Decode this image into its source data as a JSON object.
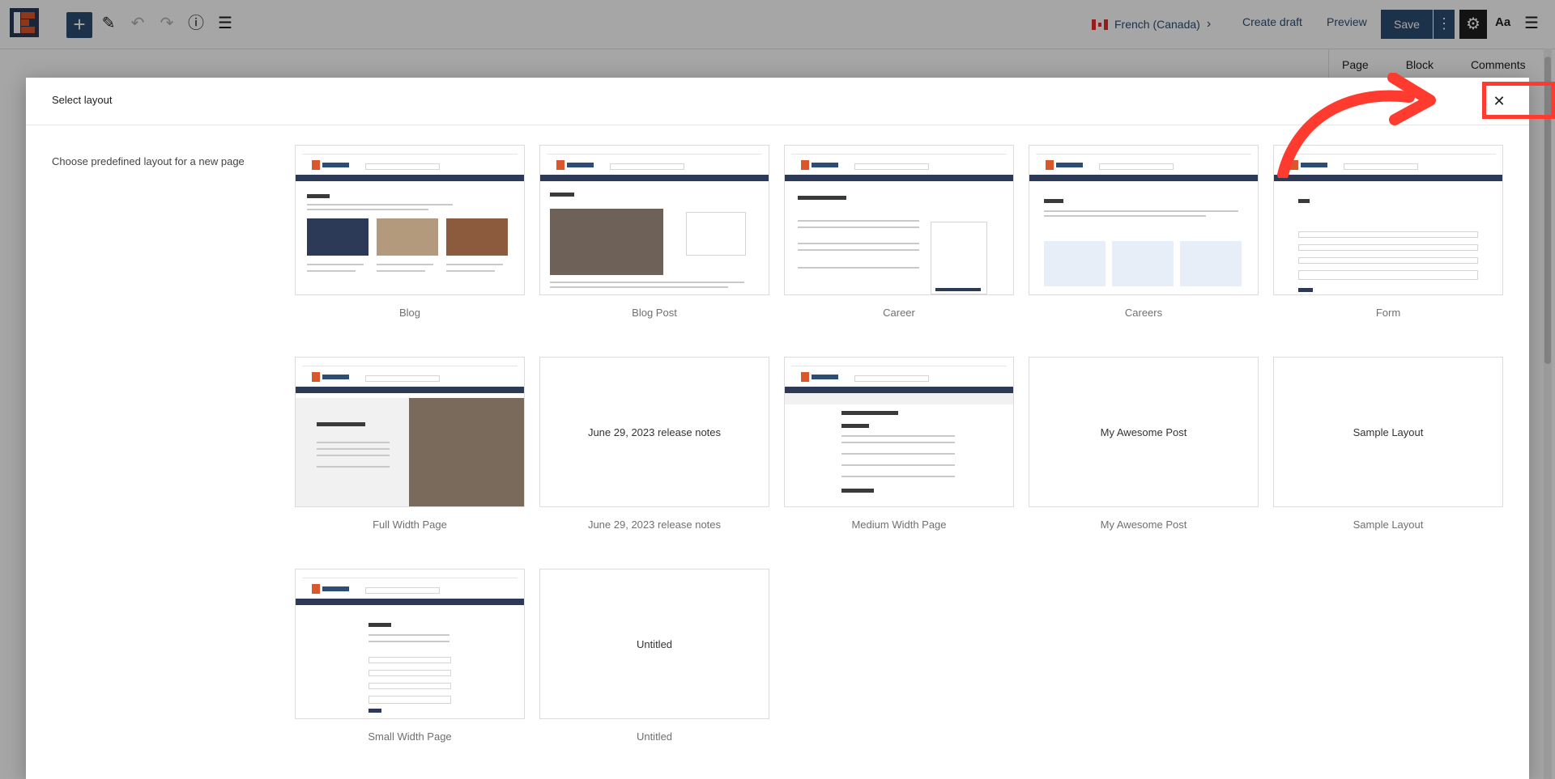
{
  "toolbar": {
    "language": "French (Canada)",
    "create_draft": "Create draft",
    "preview": "Preview",
    "save": "Save",
    "typography": "Aa"
  },
  "sidebar_tabs": [
    "Page",
    "Block",
    "Comments"
  ],
  "modal": {
    "title": "Select layout",
    "hint": "Choose predefined layout for a new page",
    "close_icon": "close-icon"
  },
  "layouts": [
    {
      "label": "Blog",
      "preview": "blog"
    },
    {
      "label": "Blog Post",
      "preview": "blog-post"
    },
    {
      "label": "Career",
      "preview": "career"
    },
    {
      "label": "Careers",
      "preview": "careers"
    },
    {
      "label": "Form",
      "preview": "form"
    },
    {
      "label": "Full Width Page",
      "preview": "full-width"
    },
    {
      "label": "June 29, 2023 release notes",
      "preview_text": "June 29, 2023 release notes"
    },
    {
      "label": "Medium Width Page",
      "preview": "medium-width"
    },
    {
      "label": "My Awesome Post",
      "preview_text": "My Awesome Post"
    },
    {
      "label": "Sample Layout",
      "preview_text": "Sample Layout"
    },
    {
      "label": "Small Width Page",
      "preview": "small-width"
    },
    {
      "label": "Untitled",
      "preview_text": "Untitled"
    }
  ],
  "colors": {
    "brand_blue": "#2c4e73",
    "brand_orange": "#d9572b",
    "annotation_red": "#ff3b30"
  }
}
